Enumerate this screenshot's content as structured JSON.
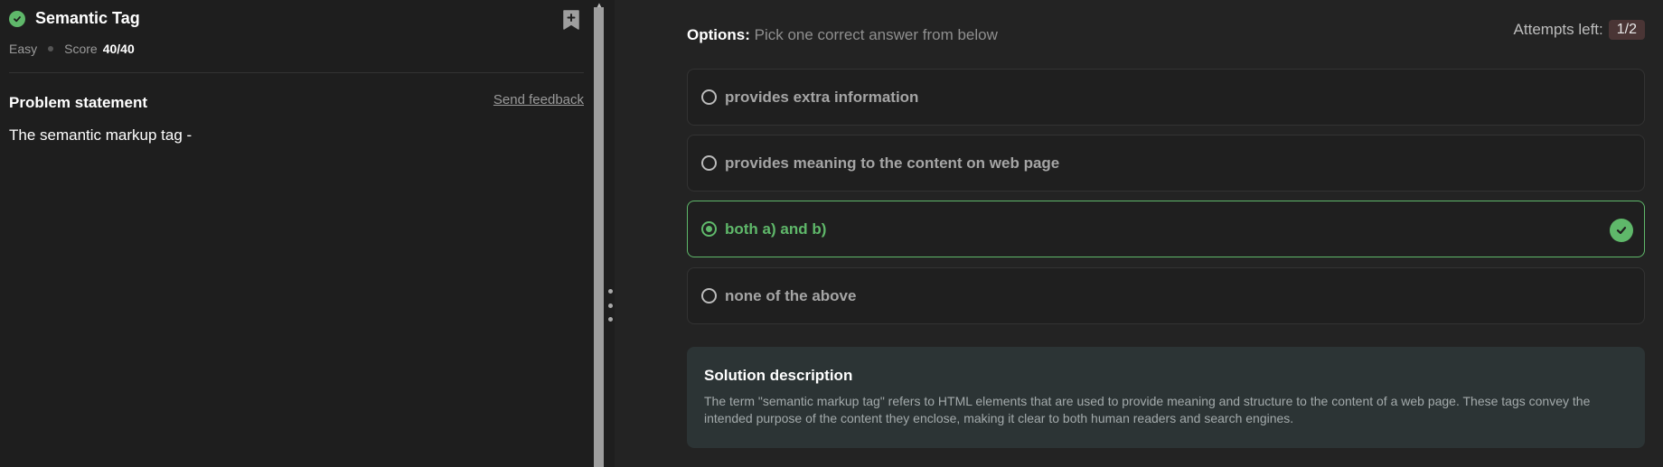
{
  "problem": {
    "title": "Semantic Tag",
    "difficulty": "Easy",
    "score_label": "Score",
    "score_value": "40/40",
    "statement_heading": "Problem statement",
    "feedback_link": "Send feedback",
    "statement_text": "The semantic markup tag -"
  },
  "quiz": {
    "options_label": "Options:",
    "options_hint": "Pick one correct answer from below",
    "attempts_label": "Attempts left:",
    "attempts_value": "1/2",
    "options": [
      {
        "text": "provides extra information",
        "selected": false
      },
      {
        "text": "provides meaning to the content on web page",
        "selected": false
      },
      {
        "text": "both a) and b)",
        "selected": true,
        "correct": true
      },
      {
        "text": "none of the above",
        "selected": false
      }
    ]
  },
  "solution": {
    "heading": "Solution description",
    "text": "The term \"semantic markup tag\" refers to HTML elements that are used to provide meaning and structure to the content of a web page. These tags convey the intended purpose of the content they enclose, making it clear to both human readers and search engines."
  },
  "colors": {
    "accent_green": "#5fb86a",
    "background": "#1e1e1e",
    "solution_bg": "#2c3435",
    "attempts_badge": "#4a3535"
  },
  "icons": [
    "check-circle-icon",
    "bookmark-add-icon",
    "radio-icon",
    "drag-handle-icon"
  ]
}
